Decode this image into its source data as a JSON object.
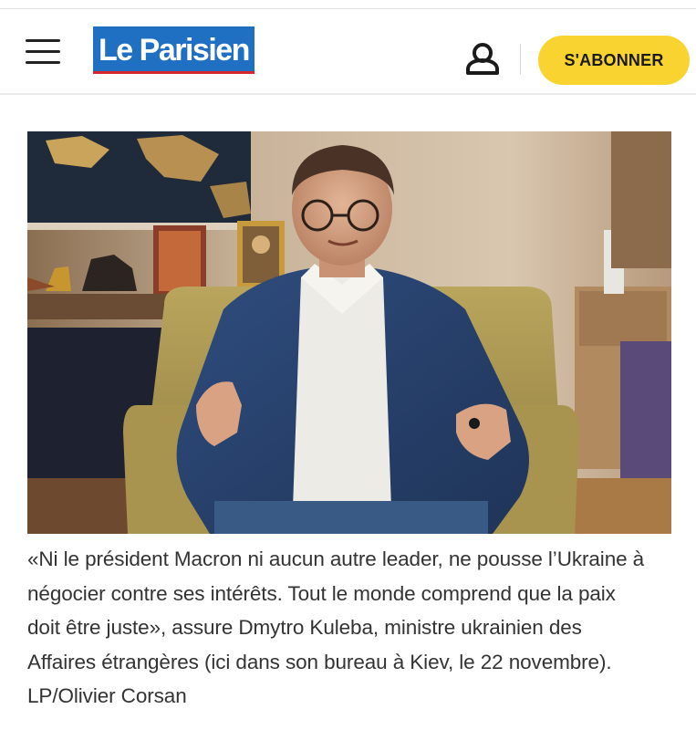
{
  "header": {
    "logo_text": "Le Parisien",
    "subscribe_label": "S'ABONNER",
    "icons": {
      "menu": "hamburger-menu-icon",
      "account": "user-icon"
    },
    "colors": {
      "logo_bg": "#1f6fc3",
      "logo_underline": "#d8262f",
      "subscribe_bg": "#f9d430"
    }
  },
  "article": {
    "caption_lines": [
      "«Ni le président Macron ni aucun autre leader, ne pousse l’Ukraine à",
      "négocier contre ses intérêts. Tout le monde comprend que la paix",
      "doit être juste», assure Dmytro Kuleba, ministre ukrainien des",
      "Affaires étrangères (ici dans son bureau à Kiev, le 22 novembre)."
    ],
    "credit": "LP/Olivier Corsan"
  }
}
